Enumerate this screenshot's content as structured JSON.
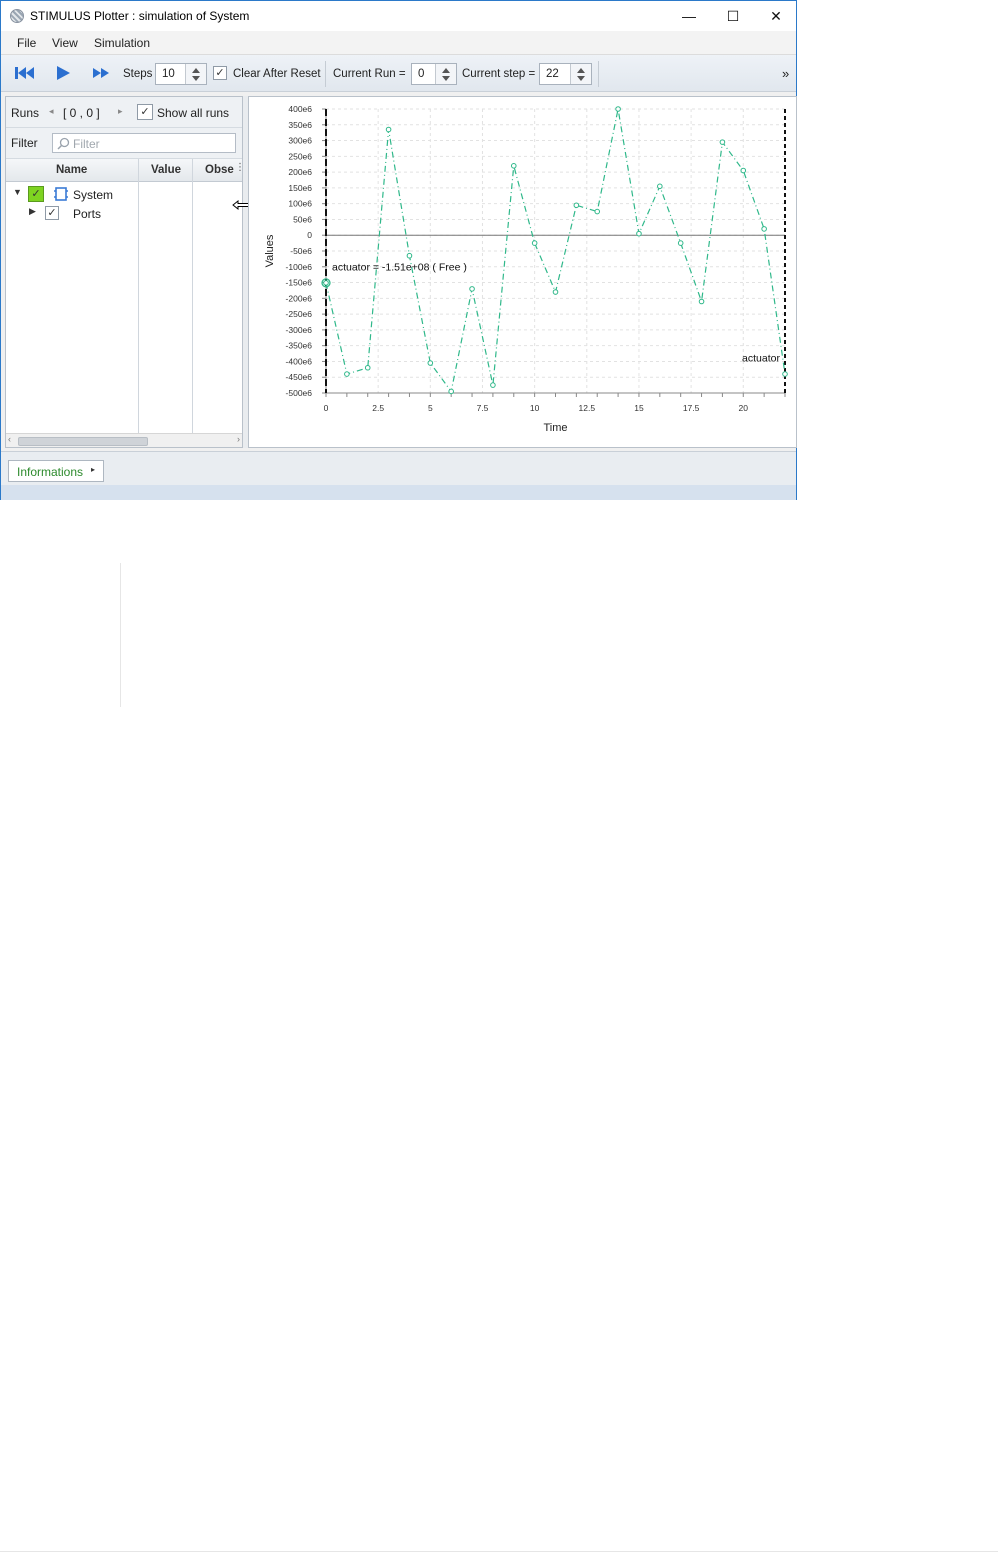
{
  "window": {
    "title": "STIMULUS Plotter : simulation of System",
    "controls": {
      "minimize": "—",
      "maximize": "☐",
      "close": "✕"
    }
  },
  "menu": {
    "items": [
      "File",
      "View",
      "Simulation"
    ]
  },
  "toolbar": {
    "icons": [
      "skip-to-start-icon",
      "play-icon",
      "fast-forward-icon"
    ],
    "steps_label": "Steps",
    "steps_value": "10",
    "clear_after_reset_label": "Clear After Reset",
    "clear_after_reset_checked": true,
    "current_run_label": "Current Run =",
    "current_run_value": "0",
    "current_step_label": "Current step =",
    "current_step_value": "22",
    "overflow": "»"
  },
  "left_panel": {
    "runs_label": "Runs",
    "runs_value": "[ 0 , 0 ]",
    "show_all_runs_label": "Show all runs",
    "show_all_runs_checked": true,
    "filter_label": "Filter",
    "filter_placeholder": "Filter",
    "columns": [
      "Name",
      "Value",
      "Obse"
    ],
    "tree": [
      {
        "label": "System",
        "expanded": true,
        "checked": true,
        "highlight": "#7ed321"
      },
      {
        "label": "Ports",
        "expanded": false,
        "checked": true
      }
    ]
  },
  "bottom": {
    "tab_label": "Informations"
  },
  "chart_data": {
    "type": "line",
    "xlabel": "Time",
    "ylabel": "Values",
    "xlim": [
      0,
      22
    ],
    "ylim": [
      -500000000,
      400000000
    ],
    "x_ticks": [
      "0",
      "2.5",
      "5",
      "7.5",
      "10",
      "12.5",
      "15",
      "17.5",
      "20"
    ],
    "y_ticks": [
      "400e6",
      "350e6",
      "300e6",
      "250e6",
      "200e6",
      "150e6",
      "100e6",
      "50e6",
      "0",
      "-50e6",
      "-100e6",
      "-150e6",
      "-200e6",
      "-250e6",
      "-300e6",
      "-350e6",
      "-400e6",
      "-450e6",
      "-500e6"
    ],
    "grid": true,
    "series": [
      {
        "name": "actuator",
        "color": "#2fb88a",
        "x": [
          0,
          1,
          2,
          3,
          4,
          5,
          6,
          7,
          8,
          9,
          10,
          11,
          12,
          13,
          14,
          15,
          16,
          17,
          18,
          19,
          20,
          21,
          22
        ],
        "y": [
          -151000000,
          -440000000,
          -420000000,
          335000000,
          -65000000,
          -405000000,
          -495000000,
          -170000000,
          -475000000,
          220000000,
          -25000000,
          -180000000,
          95000000,
          75000000,
          400000000,
          5000000,
          155000000,
          -25000000,
          -210000000,
          295000000,
          205000000,
          20000000,
          -440000000
        ]
      }
    ],
    "cursor_left": {
      "x": 0,
      "label": "actuator = -1.51e+08 ( Free )"
    },
    "cursor_right": {
      "x": 22,
      "label": "actuator"
    }
  }
}
